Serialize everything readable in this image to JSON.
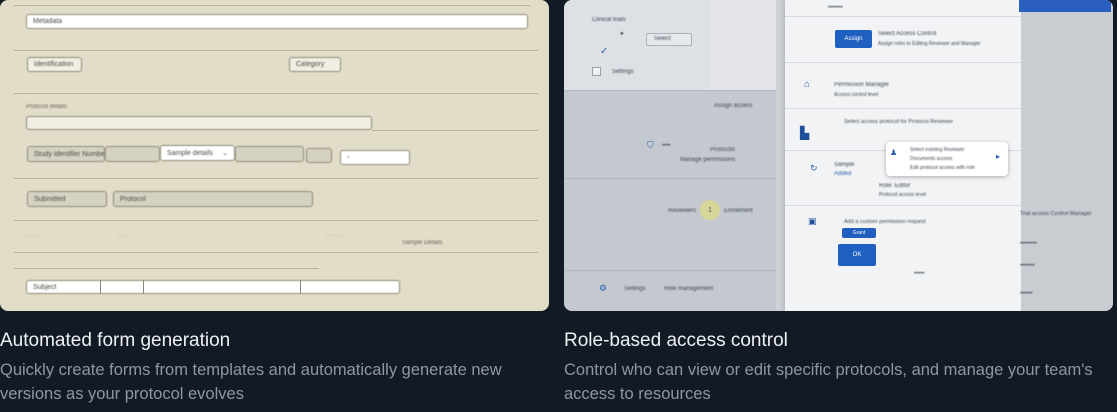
{
  "features": [
    {
      "title": "Automated form generation",
      "description": "Quickly create forms from templates and automatically generate new versions as your protocol evolves",
      "preview": {
        "labels": {
          "top_field": "Metadata",
          "row1_a": "Identification",
          "row1_b": "Category",
          "section_label": "Protocol details",
          "row3_a": "Study identifier Number",
          "row3_b": "Sample details",
          "row4_a": "Submitted",
          "row4_b": "Protocol",
          "footer_a": "Sample Details",
          "bottom_a": "Subject"
        }
      }
    },
    {
      "title": "Role-based access control",
      "description": "Control who can view or edit specific protocols, and manage your team's access to resources",
      "preview": {
        "labels": {
          "nav_top": "Clinical trials",
          "nav_settings": "Settings",
          "nav_filter": "Select",
          "btn_assign": "Assign",
          "assign_title": "Select Access Control",
          "assign_sub": "Assign roles to Editing Reviewer and Manager",
          "roles_title": "Permission Manager",
          "roles_sub": "Access control level",
          "protocols_header": "Assign access",
          "lock_title": "Select access protocol for Protocol Reviewer",
          "panel_col": "Protocols",
          "panel_sub": "Manage permissions",
          "tooltip_title": "Select existing Reviewer",
          "tooltip_line2": "Documents access",
          "tooltip_line3": "Edit protocol access with role",
          "member_title": "Sample",
          "member_sub": "Added",
          "role_line": "Role: Editor",
          "role_line2": "Protocol access level",
          "step_label": "Reviewers",
          "step_num": "1",
          "step_next": "Enrollment",
          "req_title": "Add a custom permission request",
          "btn_add": "Grant",
          "btn_ok": "OK",
          "footer_title": "Settings",
          "footer_sub": "Role management",
          "side_title": "Trial access Control Manager"
        }
      }
    }
  ]
}
